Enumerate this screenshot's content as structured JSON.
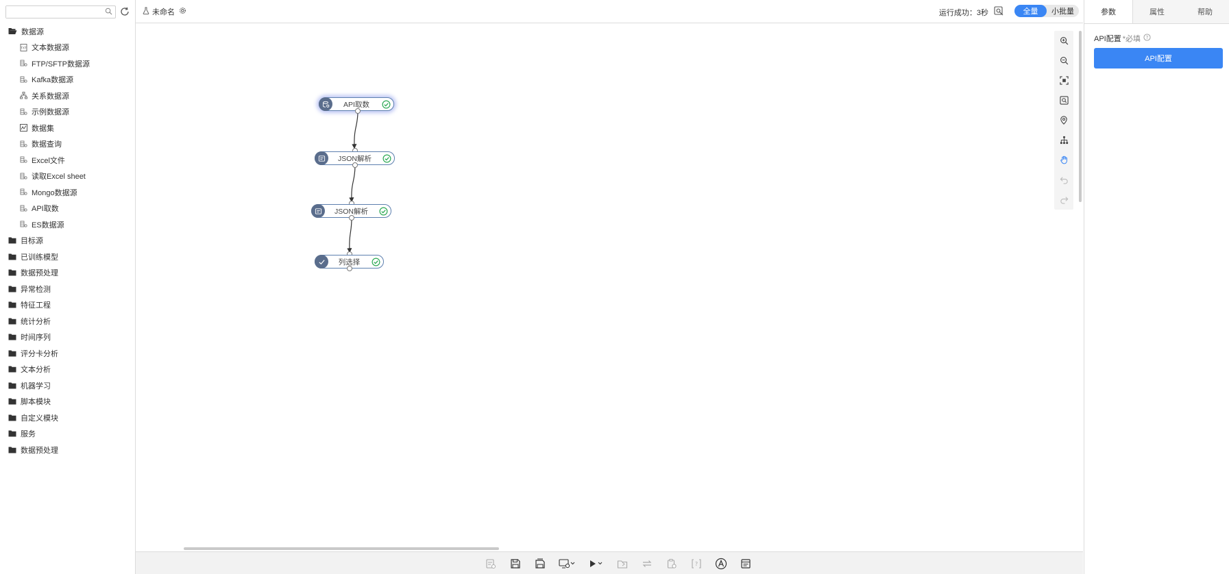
{
  "sidebar": {
    "search_placeholder": "",
    "tree": [
      {
        "label": "数据源",
        "open": true,
        "children": [
          {
            "label": "文本数据源",
            "icon": "text-file-icon"
          },
          {
            "label": "FTP/SFTP数据源",
            "icon": "database-icon"
          },
          {
            "label": "Kafka数据源",
            "icon": "database-icon"
          },
          {
            "label": "关系数据源",
            "icon": "relation-icon"
          },
          {
            "label": "示例数据源",
            "icon": "database-icon"
          },
          {
            "label": "数据集",
            "icon": "chart-icon"
          },
          {
            "label": "数据查询",
            "icon": "database-icon"
          },
          {
            "label": "Excel文件",
            "icon": "database-icon"
          },
          {
            "label": "读取Excel sheet",
            "icon": "database-icon"
          },
          {
            "label": "Mongo数据源",
            "icon": "database-icon"
          },
          {
            "label": "API取数",
            "icon": "database-icon"
          },
          {
            "label": "ES数据源",
            "icon": "database-icon"
          }
        ]
      },
      {
        "label": "目标源"
      },
      {
        "label": "已训练模型"
      },
      {
        "label": "数据预处理"
      },
      {
        "label": "异常检测"
      },
      {
        "label": "特征工程"
      },
      {
        "label": "统计分析"
      },
      {
        "label": "时间序列"
      },
      {
        "label": "评分卡分析"
      },
      {
        "label": "文本分析"
      },
      {
        "label": "机器学习"
      },
      {
        "label": "脚本模块"
      },
      {
        "label": "自定义模块"
      },
      {
        "label": "服务"
      },
      {
        "label": "数据预处理"
      }
    ]
  },
  "topbar": {
    "title": "未命名",
    "run_status": "运行成功：3秒",
    "mode_options": [
      "全量",
      "小批量"
    ],
    "mode_active": 0
  },
  "canvas": {
    "nodes": [
      {
        "label": "API取数",
        "selected": true
      },
      {
        "label": "JSON解析",
        "selected": false
      },
      {
        "label": "JSON解析",
        "selected": false
      },
      {
        "label": "列选择",
        "selected": false
      }
    ],
    "tools": [
      "zoom-in-icon",
      "zoom-out-icon",
      "fit-screen-icon",
      "actual-size-icon",
      "locate-icon",
      "layout-icon",
      "hand-icon",
      "undo-icon",
      "redo-icon"
    ]
  },
  "bottom_toolbar": {
    "tools": [
      "report-icon",
      "save-icon",
      "save-as-icon",
      "monitor-icon",
      "run-icon",
      "export-icon",
      "switch-icon",
      "clipboard-icon",
      "debug-icon",
      "font-icon",
      "notes-icon"
    ]
  },
  "right_panel": {
    "tabs": [
      "参数",
      "属性",
      "帮助"
    ],
    "active_tab": 0,
    "param_label": "API配置",
    "required_text": "*必填",
    "button_label": "API配置"
  },
  "colors": {
    "accent": "#3a86f4",
    "node_border": "#5c7fae",
    "node_icon": "#5a6d8c",
    "success": "#2eaa55"
  }
}
